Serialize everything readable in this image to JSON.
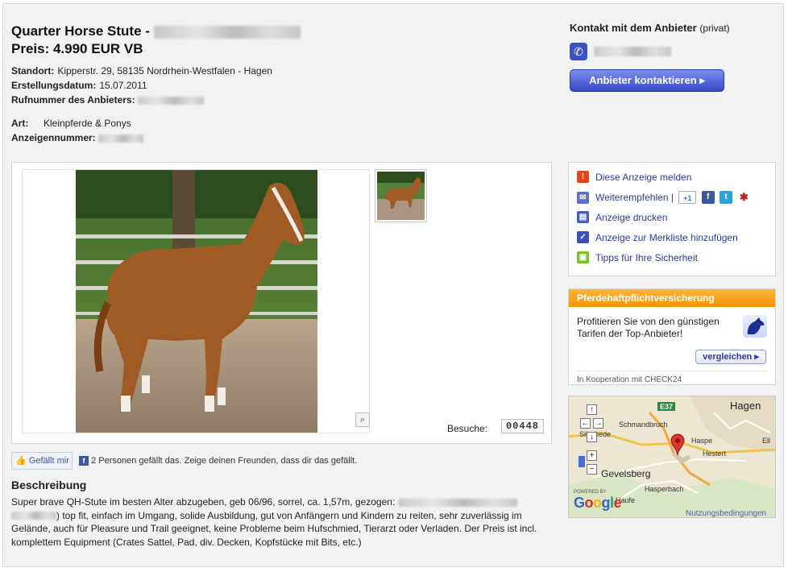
{
  "header": {
    "title_prefix": "Quarter Horse Stute -",
    "price": "Preis: 4.990 EUR VB"
  },
  "details": {
    "standort_label": "Standort:",
    "standort_value": "Kipperstr. 29, 58135 Nordrhein-Westfalen - Hagen",
    "erstellung_label": "Erstellungsdatum:",
    "erstellung_value": "15.07.2011",
    "rufnummer_label": "Rufnummer des Anbieters:",
    "art_label": "Art:",
    "art_value": "Kleinpferde & Ponys",
    "anzeigennummer_label": "Anzeigennummer:"
  },
  "contact": {
    "title": "Kontakt mit dem Anbieter",
    "type": "(privat)",
    "button_label": "Anbieter kontaktieren ▸"
  },
  "gallery": {
    "visits_label": "Besuche:",
    "visits_count": "00448"
  },
  "social": {
    "like_label": "Gefällt mir",
    "like_text": "2 Personen gefällt das. Zeige deinen Freunden, dass dir das gefällt."
  },
  "description": {
    "title": "Beschreibung",
    "text_part1": "Super brave QH-Stute im besten Alter abzugeben, geb 06/96, sorrel, ca. 1,57m, gezogen:",
    "text_part2": ") top fit, einfach im Umgang, solide Ausbildung, gut von Anfängern und Kindern zu reiten, sehr zuverlässig im Gelände, auch für Pleasure und Trail geeignet, keine Probleme beim Hufschmied, Tierarzt oder Verladen. Der Preis ist incl. komplettem Equipment (Crates Sattel, Pad, div. Decken, Kopfstücke mit Bits, etc.)"
  },
  "actions": {
    "report": "Diese Anzeige melden",
    "share": "Weiterempfehlen |",
    "print": "Anzeige drucken",
    "watchlist": "Anzeige zur Merkliste hinzufügen",
    "safety": "Tipps für Ihre Sicherheit",
    "gplus_label": "+1"
  },
  "insurance": {
    "header": "Pferdehaftpflichtversicherung",
    "text": "Profitieren Sie von den günstigen Tarifen der Top-Anbieter!",
    "button_label": "vergleichen ▸",
    "cooperation": "In Kooperation mit CHECK24"
  },
  "map": {
    "city_hagen": "Hagen",
    "city_gevelsberg": "Gevelsberg",
    "schmandbruch": "Schmandbruch",
    "haspe": "Haspe",
    "hestert": "Hestert",
    "hasperbach": "Hasperbach",
    "haufe": "Haufe",
    "silschede": "Silschede",
    "ell": "Ell",
    "highway": "E37",
    "powered_by": "POWERED BY",
    "google": "Google",
    "terms": "Nutzungsbedingungen"
  },
  "colors": {
    "link": "#2a3aa8",
    "button_blue": "#3448c6",
    "orange": "#f39400",
    "facebook": "#3b5998"
  }
}
